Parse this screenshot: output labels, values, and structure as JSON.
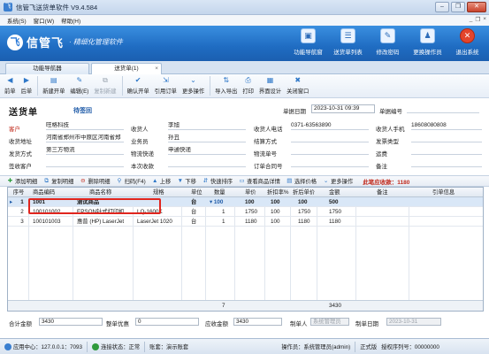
{
  "window": {
    "title": "信管飞送货单软件 V9.4.584",
    "app_icon": "飞",
    "minimize_glyph": "–",
    "maximize_glyph": "❐",
    "close_glyph": "✕"
  },
  "menu": {
    "items": [
      "系统(S)",
      "窗口(W)",
      "帮助(H)"
    ],
    "mdi_controls": [
      "_",
      "❐",
      "×"
    ]
  },
  "banner": {
    "logo_glyph": "飞",
    "logo_name": "信管飞",
    "slogan": "· 精细化管理软件",
    "buttons": [
      {
        "label": "功能导航窗",
        "icon": "monitor-icon",
        "glyph": "▣"
      },
      {
        "label": "送货单列表",
        "icon": "list-icon",
        "glyph": "☰"
      },
      {
        "label": "修改密码",
        "icon": "lock-icon",
        "glyph": "✎"
      },
      {
        "label": "更换操作员",
        "icon": "user-switch-icon",
        "glyph": "♟"
      },
      {
        "label": "退出系统",
        "icon": "exit-icon",
        "glyph": "✕"
      }
    ]
  },
  "tabs": [
    {
      "label": "功能导航器",
      "active": false
    },
    {
      "label": "送货单(1)",
      "active": true,
      "close": "×"
    }
  ],
  "toolbar": {
    "buttons": [
      {
        "label": "前单",
        "icon": "arrow-left-icon",
        "glyph": "◀",
        "dim": false
      },
      {
        "label": "后单",
        "icon": "arrow-right-icon",
        "glyph": "▶",
        "dim": false
      },
      {
        "label": "新建开单",
        "icon": "new-document-icon",
        "glyph": "▤",
        "dim": false
      },
      {
        "label": "编辑(E)",
        "icon": "edit-icon",
        "glyph": "✎",
        "dim": false
      },
      {
        "label": "复制新建",
        "icon": "copy-new-icon",
        "glyph": "⧉",
        "dim": true
      },
      {
        "label": "确认开单",
        "icon": "confirm-icon",
        "glyph": "✔",
        "dim": false
      },
      {
        "label": "引用订单",
        "icon": "reference-order-icon",
        "glyph": "⇲",
        "dim": false
      },
      {
        "label": "更多操作",
        "icon": "more-actions-icon",
        "glyph": "⌄",
        "dim": false
      },
      {
        "label": "导入导出",
        "icon": "import-export-icon",
        "glyph": "⇅",
        "dim": false
      },
      {
        "label": "打印",
        "icon": "printer-icon",
        "glyph": "⎙",
        "dim": false
      },
      {
        "label": "界面设计",
        "icon": "layout-design-icon",
        "glyph": "▦",
        "dim": false
      },
      {
        "label": "关闭窗口",
        "icon": "close-window-icon",
        "glyph": "✖",
        "dim": false
      }
    ]
  },
  "header": {
    "doc_title": "送货单",
    "doc_status": "待签回",
    "date_label": "单据日期",
    "date_value": "2023-10-31 09:39",
    "doc_no_label": "单据编号",
    "doc_no_value": "",
    "fields": {
      "customer_label": "客户",
      "customer_value": "旺格科技",
      "receiver_label": "收货人",
      "receiver_value": "李旭",
      "receiver_phone_label": "收货人电话",
      "receiver_phone_value": "0371-63563890",
      "receiver_mobile_label": "收货人手机",
      "receiver_mobile_value": "18608080808",
      "address_label": "收货地址",
      "address_value": "河南省郑州市中原区河南省郑",
      "salesman_label": "业务员",
      "salesman_value": "孙丑",
      "settle_label": "结算方式",
      "settle_value": "",
      "invoice_type_label": "发票类型",
      "invoice_type_value": "",
      "ship_method_label": "发货方式",
      "ship_method_value": "第三方物流",
      "logistics_label": "物流快递",
      "logistics_value": "申通快递",
      "tracking_label": "物流单号",
      "tracking_value": "",
      "freight_label": "运费",
      "freight_value": "",
      "sign_customer_label": "签收客户",
      "sign_customer_value": "",
      "received_label": "本次收款",
      "received_value": "",
      "order_no_label": "订单合同号",
      "order_no_value": "",
      "remark_label": "备注",
      "remark_value": ""
    }
  },
  "grid_toolbar": {
    "buttons": [
      {
        "label": "添加明细",
        "icon": "add-row-icon",
        "glyph": "✚",
        "tone": "green"
      },
      {
        "label": "复制明细",
        "icon": "copy-row-icon",
        "glyph": "⧉",
        "tone": "blue"
      },
      {
        "label": "删除明细",
        "icon": "delete-row-icon",
        "glyph": "⊖",
        "tone": "red"
      },
      {
        "label": "扫码(F4)",
        "icon": "barcode-icon",
        "glyph": "⚲",
        "tone": "blue"
      },
      {
        "label": "上移",
        "icon": "move-up-icon",
        "glyph": "▲",
        "tone": "blue"
      },
      {
        "label": "下移",
        "icon": "move-down-icon",
        "glyph": "▼",
        "tone": "blue"
      },
      {
        "label": "快速排序",
        "icon": "sort-icon",
        "glyph": "⇵",
        "tone": "blue"
      },
      {
        "label": "查看商品详情",
        "icon": "product-detail-icon",
        "glyph": "▭",
        "tone": "blue"
      },
      {
        "label": "选择价格",
        "icon": "price-select-icon",
        "glyph": "▤",
        "tone": "blue"
      },
      {
        "label": "更多操作",
        "icon": "more-actions-icon",
        "glyph": "⌄",
        "tone": "blue"
      }
    ],
    "total_text": "此笔应收款：1180"
  },
  "grid": {
    "columns": [
      "序号",
      "商品编码",
      "商品名称",
      "规格",
      "单位",
      "数量",
      "单价",
      "折扣率%",
      "折后单价",
      "金额",
      "备注",
      "引单信息"
    ],
    "rows": [
      {
        "marker": "▸",
        "no": "1",
        "code": "1001",
        "name": "测试商品",
        "spec": "",
        "unit": "台",
        "qty": "▾ 100",
        "price": "100",
        "discount": "100",
        "net_price": "100",
        "amount": "500",
        "remark": "",
        "ref": ""
      },
      {
        "marker": "",
        "no": "2",
        "code": "100101002",
        "name": "EPSON针式打印机",
        "spec": "LQ-1600K",
        "unit": "台",
        "qty": "1",
        "price": "1750",
        "discount": "100",
        "net_price": "1750",
        "amount": "1750",
        "remark": "",
        "ref": ""
      },
      {
        "marker": "",
        "no": "3",
        "code": "100101003",
        "name": "惠普 (HP) LaserJet",
        "spec": "LaserJet 1020",
        "unit": "台",
        "qty": "1",
        "price": "1180",
        "discount": "100",
        "net_price": "1180",
        "amount": "1180",
        "remark": "",
        "ref": ""
      }
    ],
    "footer": {
      "qty_total": "7",
      "amount_total": "3430"
    }
  },
  "footer_fields": {
    "total_label": "合计金额",
    "total_value": "3430",
    "discount_label": "整单优惠",
    "discount_value": "0",
    "receivable_label": "应收金额",
    "receivable_value": "3430",
    "maker_label": "制单人",
    "maker_value": "系统管理员",
    "make_date_label": "制单日期",
    "make_date_value": "2023-10-31"
  },
  "statusbar": {
    "center": "应用中心：127.0.0.1：7093",
    "connection": "连接状态：正常",
    "account": "账套：演示账套",
    "operator": "操作员：系统管理员(admin)",
    "edition": "正式版",
    "license": "授权序列号：00000000"
  },
  "colors": {
    "banner": "#1f6cc2",
    "accent_red": "#c0281a",
    "status_blue": "#1f5ba8",
    "highlight_box": "#e0251e"
  }
}
